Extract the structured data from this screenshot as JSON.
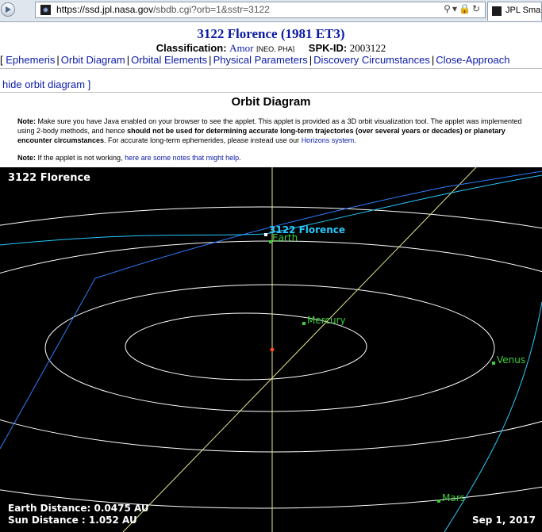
{
  "browser": {
    "url_host": "https://ssd.jpl.nasa.gov",
    "url_path": "/sbdb.cgi?orb=1&sstr=3122",
    "tab_label": "JPL Sma"
  },
  "header": {
    "title": "3122 Florence (1981 ET3)",
    "classification_label": "Classification:",
    "classification_value": "Amor",
    "classification_tags": "[NEO, PHA]",
    "spk_label": "SPK-ID:",
    "spk_value": "2003122"
  },
  "nav": {
    "items": [
      "Ephemeris",
      "Orbit Diagram",
      "Orbital Elements",
      "Physical Parameters",
      "Discovery Circumstances",
      "Close-Approach"
    ]
  },
  "hide_link": "hide orbit diagram",
  "orbit_section": {
    "title": "Orbit Diagram",
    "note_label": "Note:",
    "note1_a": " Make sure you have Java enabled on your browser to see the applet. This applet is provided as a 3D orbit visualization tool. The applet was implemented using 2-body methods, and hence ",
    "note1_bold": "should not be used for determining accurate long-term trajectories (over several years or decades) or planetary encounter circumstances",
    "note1_b": ". For accurate long-term ephemerides, please instead use our ",
    "note1_link": "Horizons system",
    "note1_end": ".",
    "note2_a": " If the applet is not working, ",
    "note2_link": "here are some notes that might help",
    "note2_end": "."
  },
  "applet": {
    "title": "3122 Florence",
    "earth_distance": "Earth Distance: 0.0475 AU",
    "sun_distance": "Sun Distance  : 1.052 AU",
    "date": "Sep 1, 2017",
    "labels": {
      "florence": "3122 Florence",
      "earth": "Earth",
      "mercury": "Mercury",
      "venus": "Venus",
      "mars": "Mars"
    },
    "colors": {
      "background": "#000000",
      "orbits": "#ffffff",
      "planets": "#3ccc3c",
      "asteroid": "#28c8ff",
      "axis": "#e6e68c"
    }
  }
}
